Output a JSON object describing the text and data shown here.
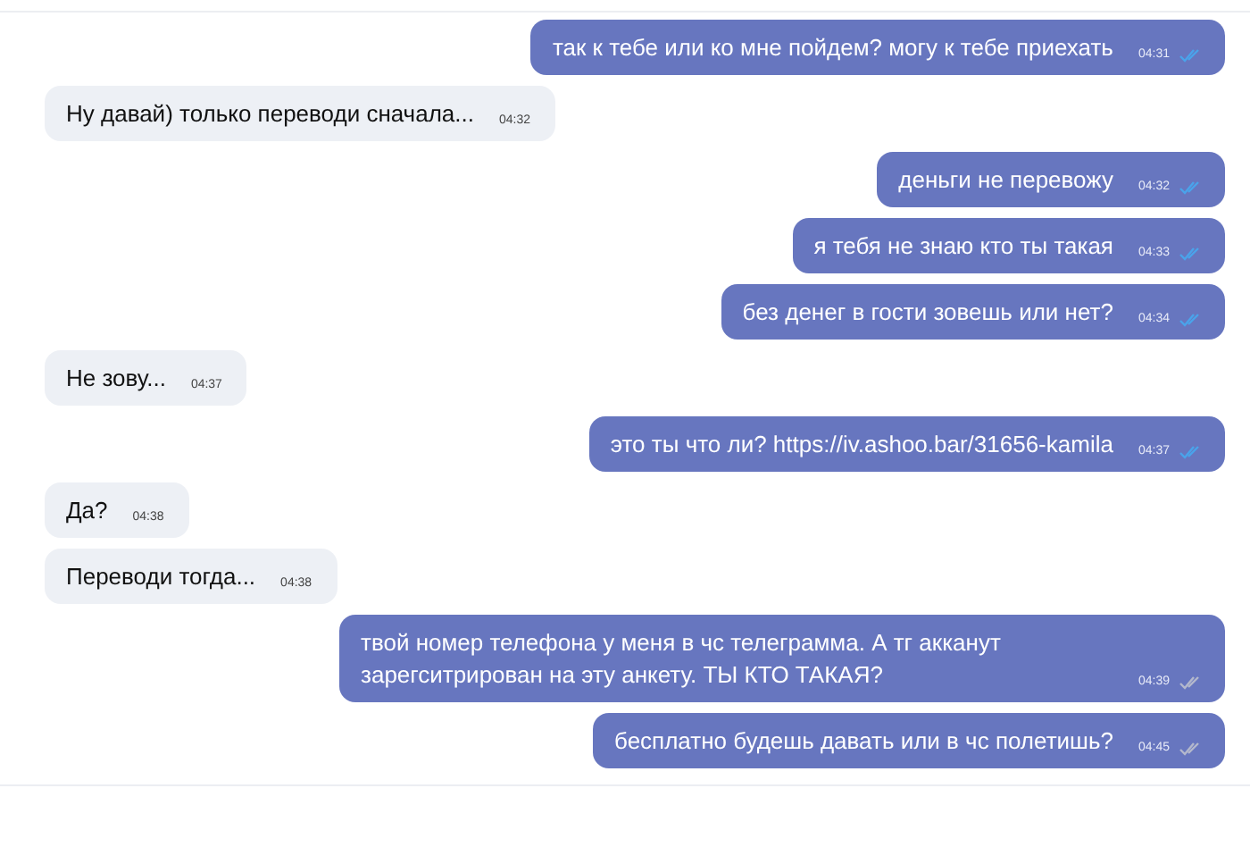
{
  "messages": [
    {
      "kind": "outgoing",
      "text": "так к тебе или ко мне пойдем? могу к тебе приехать",
      "time": "04:31",
      "read": true
    },
    {
      "kind": "incoming",
      "text": "Ну давай) только переводи сначала...",
      "time": "04:32"
    },
    {
      "kind": "outgoing",
      "text": "деньги не перевожу",
      "time": "04:32",
      "read": true
    },
    {
      "kind": "outgoing",
      "text": "я тебя не знаю кто ты такая",
      "time": "04:33",
      "read": true
    },
    {
      "kind": "outgoing",
      "text": "без денег в гости зовешь или нет?",
      "time": "04:34",
      "read": true
    },
    {
      "kind": "incoming",
      "text": "Не зову...",
      "time": "04:37"
    },
    {
      "kind": "outgoing",
      "text": "это ты что ли? https://iv.ashoo.bar/31656-kamila",
      "time": "04:37",
      "read": true
    },
    {
      "kind": "incoming",
      "text": "Да?",
      "time": "04:38"
    },
    {
      "kind": "incoming",
      "text": "Переводи тогда...",
      "time": "04:38"
    },
    {
      "kind": "outgoing",
      "text": "твой номер телефона у меня в чс телеграмма. А тг акканут зарегситрирован на эту анкету. ТЫ КТО ТАКАЯ?",
      "time": "04:39",
      "read": false
    },
    {
      "kind": "outgoing",
      "text": "бесплатно будешь давать или в чс полетишь?",
      "time": "04:45",
      "read": false
    }
  ]
}
